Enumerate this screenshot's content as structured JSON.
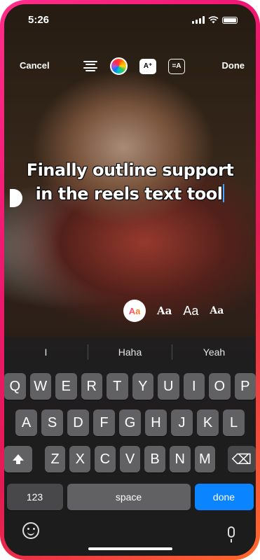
{
  "status_bar": {
    "time": "5:26"
  },
  "toolbar": {
    "cancel_label": "Cancel",
    "done_label": "Done",
    "effects_icon_label": "A⁺",
    "outline_icon_label": "=A"
  },
  "caption": {
    "line1": "Finally outline support",
    "line2": "in the reels text tool"
  },
  "font_styles": [
    "Aa",
    "Aa",
    "Aa",
    "Aa"
  ],
  "suggestions": [
    "I",
    "Haha",
    "Yeah"
  ],
  "keyboard": {
    "row1": [
      "Q",
      "W",
      "E",
      "R",
      "T",
      "Y",
      "U",
      "I",
      "O",
      "P"
    ],
    "row2": [
      "A",
      "S",
      "D",
      "F",
      "G",
      "H",
      "J",
      "K",
      "L"
    ],
    "row3": [
      "Z",
      "X",
      "C",
      "V",
      "B",
      "N",
      "M"
    ],
    "numbers_label": "123",
    "space_label": "space",
    "return_label": "done",
    "delete_glyph": "⌫"
  },
  "colors": {
    "frame_gradient": [
      "#ff2e8a",
      "#ff6a2a"
    ],
    "done_key": "#0a84ff",
    "caret": "#4aa3ff"
  }
}
